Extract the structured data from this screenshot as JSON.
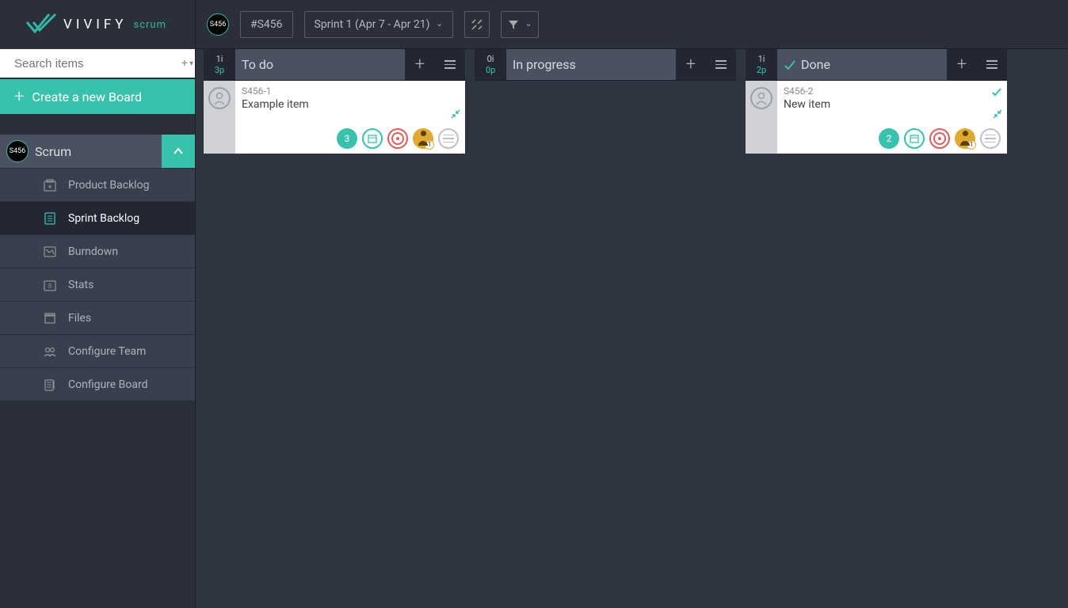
{
  "app": {
    "name": "VIVIFY",
    "product": "scrum"
  },
  "search": {
    "placeholder": "Search items",
    "add_label": "+▾"
  },
  "create_board_label": "Create a new Board",
  "board": {
    "badge": "S456",
    "name": "Scrum"
  },
  "menu": [
    {
      "id": "product-backlog",
      "label": "Product Backlog",
      "active": false
    },
    {
      "id": "sprint-backlog",
      "label": "Sprint Backlog",
      "active": true
    },
    {
      "id": "burndown",
      "label": "Burndown",
      "active": false
    },
    {
      "id": "stats",
      "label": "Stats",
      "active": false
    },
    {
      "id": "files",
      "label": "Files",
      "active": false
    },
    {
      "id": "configure-team",
      "label": "Configure Team",
      "active": false
    },
    {
      "id": "configure-board",
      "label": "Configure Board",
      "active": false
    }
  ],
  "topbar": {
    "board_id": "#S456",
    "sprint_label": "Sprint 1 (Apr 7 - Apr 21)"
  },
  "columns": [
    {
      "id": "todo",
      "title": "To do",
      "items_count": "1i",
      "points": "3p",
      "done": false,
      "cards": [
        {
          "id": "S456-1",
          "title": "Example item",
          "points": "3",
          "person_badge": "1",
          "checked": false
        }
      ]
    },
    {
      "id": "inprogress",
      "title": "In progress",
      "items_count": "0i",
      "points": "0p",
      "done": false,
      "cards": []
    },
    {
      "id": "done",
      "title": "Done",
      "items_count": "1i",
      "points": "2p",
      "done": true,
      "cards": [
        {
          "id": "S456-2",
          "title": "New item",
          "points": "2",
          "person_badge": "1",
          "checked": true
        }
      ]
    }
  ]
}
